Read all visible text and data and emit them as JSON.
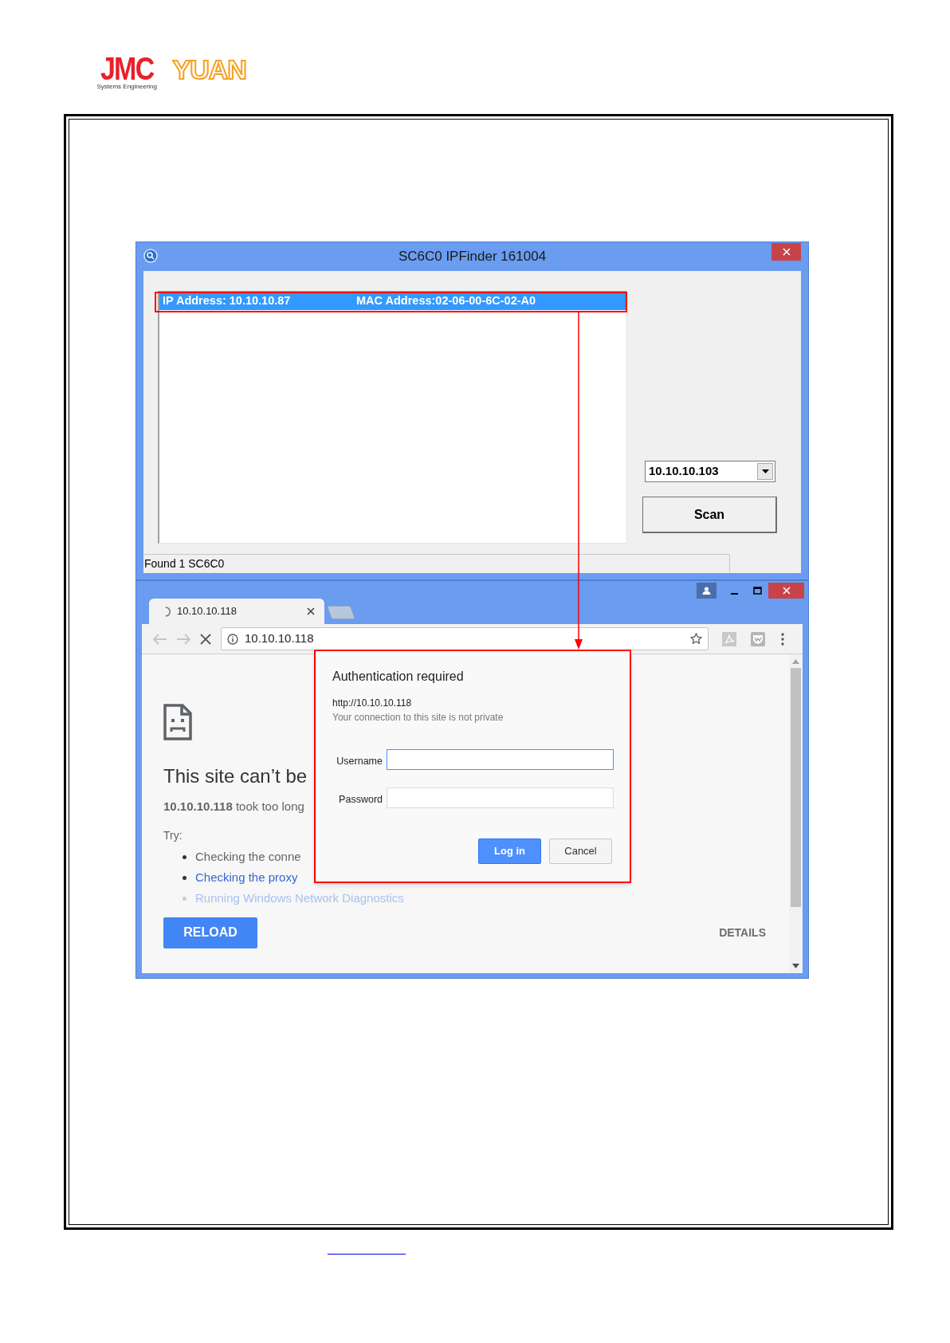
{
  "logo": {
    "brand": "JMC",
    "tagline": "Systems Engineering",
    "partner": "YUAN"
  },
  "ipfinder": {
    "title": "SC6C0 IPFinder 161004",
    "devices": [
      {
        "ip": "IP Address: 10.10.10.87",
        "mac": "MAC Address:02-06-00-6C-02-A0",
        "selected": true,
        "highlighted": true
      }
    ],
    "interface": "10.10.10.103",
    "scan": "Scan",
    "status": "Found 1 SC6C0"
  },
  "browser": {
    "tabs": [
      {
        "title": "10.10.10.118",
        "loading": true,
        "selected": true
      }
    ],
    "address": "10.10.10.118",
    "page": {
      "heading": "This site can’t be",
      "message": "**10.10.10.118** took too long",
      "try_label": "Try:",
      "suggestions": [
        {
          "text": "Checking the conne",
          "kind": "plain"
        },
        {
          "text": "Checking the proxy",
          "kind": "link"
        },
        {
          "text": "Running Windows Network Diagnostics",
          "kind": "faded"
        }
      ],
      "reload": "RELOAD",
      "details": "DETAILS"
    }
  },
  "auth_dialog": {
    "title": "Authentication required",
    "origin": "http://10.10.10.118",
    "note": "Your connection to this site is not private",
    "highlighted": true,
    "fields": [
      {
        "label": "Username",
        "focused": true
      },
      {
        "label": "Password",
        "focused": false
      }
    ],
    "buttons": [
      {
        "label": "Log in",
        "kind": "primary"
      },
      {
        "label": "Cancel",
        "kind": "secondary"
      }
    ]
  },
  "annotation": {
    "arrow": true
  }
}
